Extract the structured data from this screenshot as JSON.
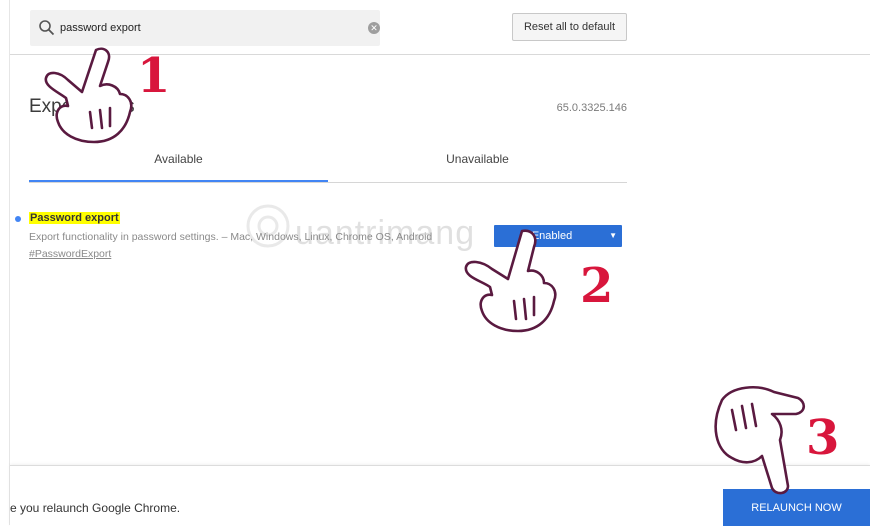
{
  "search": {
    "value": "password export",
    "clear_icon": "close-circle-icon"
  },
  "header": {
    "reset_label": "Reset all to default"
  },
  "page": {
    "title": "Experiments",
    "version": "65.0.3325.146"
  },
  "tabs": [
    {
      "label": "Available",
      "active": true
    },
    {
      "label": "Unavailable",
      "active": false
    }
  ],
  "experiment": {
    "name": "Password export",
    "description": "Export functionality in password settings. – Mac, Windows, Linux, Chrome OS, Android",
    "link": "#PasswordExport",
    "selected_value": "Enabled"
  },
  "relaunch": {
    "message": "e you relaunch Google Chrome.",
    "button_label": "RELAUNCH NOW"
  },
  "annotations": {
    "steps": [
      "1",
      "2",
      "3"
    ],
    "color": "#d8163c"
  },
  "watermark": {
    "text": "uantrimang"
  },
  "colors": {
    "accent": "#2b6fd6",
    "highlight": "#ffff00",
    "tab_indicator": "#4285f4"
  }
}
